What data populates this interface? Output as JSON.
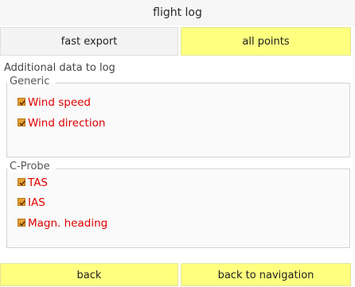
{
  "header": {
    "title": "flight log"
  },
  "tabs": [
    {
      "label": "fast export",
      "selected": false
    },
    {
      "label": "all points",
      "selected": true
    }
  ],
  "section_label": "Additional data to log",
  "groups": [
    {
      "title": "Generic",
      "items": [
        {
          "label": "Wind speed",
          "checked": true
        },
        {
          "label": "Wind direction",
          "checked": true
        }
      ]
    },
    {
      "title": "C-Probe",
      "items": [
        {
          "label": "TAS",
          "checked": true
        },
        {
          "label": "IAS",
          "checked": true
        },
        {
          "label": "Magn. heading",
          "checked": true
        }
      ]
    }
  ],
  "footer": {
    "back_label": "back",
    "nav_label": "back to navigation"
  },
  "colors": {
    "accent_yellow": "#ffff80",
    "check_text": "#e00000",
    "check_box": "#e6a030"
  },
  "icons": {
    "checkbox": "checkbox-checked-icon"
  }
}
